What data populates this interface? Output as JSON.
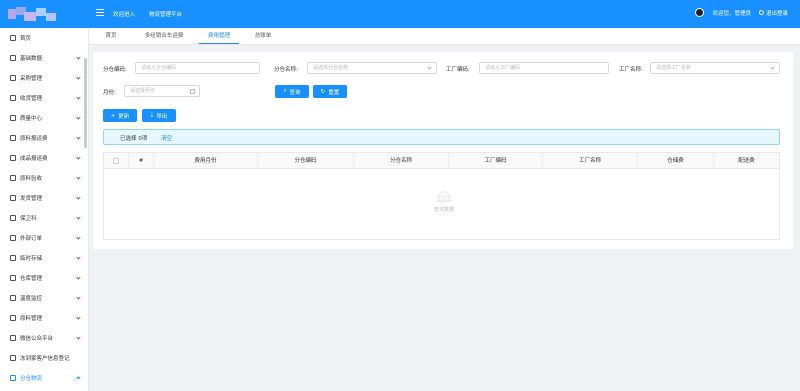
{
  "header": {
    "welcome": "欢迎进入",
    "system_name": "物流管理平台",
    "user_greeting": "欢迎您，管理员",
    "logout_label": "退出登录",
    "brand_color": "#1890ff"
  },
  "sidebar": {
    "items": [
      {
        "label": "首页",
        "icon": "home-icon"
      },
      {
        "label": "基础数据",
        "icon": "database-icon"
      },
      {
        "label": "采购管理",
        "icon": "cart-icon"
      },
      {
        "label": "收货管理",
        "icon": "receive-icon"
      },
      {
        "label": "质量中心",
        "icon": "quality-icon"
      },
      {
        "label": "原料报运费",
        "icon": "freight-icon"
      },
      {
        "label": "成品报运费",
        "icon": "product-freight-icon"
      },
      {
        "label": "原料验收",
        "icon": "inspect-icon"
      },
      {
        "label": "发货管理",
        "icon": "ship-icon"
      },
      {
        "label": "保卫科",
        "icon": "shield-icon"
      },
      {
        "label": "外部订单",
        "icon": "order-icon"
      },
      {
        "label": "临时存储",
        "icon": "storage-icon"
      },
      {
        "label": "仓库管理",
        "icon": "warehouse-icon"
      },
      {
        "label": "温度监控",
        "icon": "temperature-icon"
      },
      {
        "label": "原料管理",
        "icon": "material-icon"
      },
      {
        "label": "微信公众平台",
        "icon": "wechat-icon"
      },
      {
        "label": "冻到家客户信息登记",
        "icon": "customer-icon"
      },
      {
        "label": "分仓物流",
        "icon": "logistics-icon"
      }
    ]
  },
  "tabs": [
    {
      "label": "首页"
    },
    {
      "label": "多经销合车运费"
    },
    {
      "label": "费用管理"
    },
    {
      "label": "总账单"
    }
  ],
  "filters": {
    "branch_code_label": "分仓编码:",
    "branch_code_placeholder": "请输入分仓编码",
    "branch_name_label": "分仓名称:",
    "branch_name_placeholder": "请选择分仓名称",
    "factory_code_label": "工厂编码:",
    "factory_code_placeholder": "请输入工厂编码",
    "factory_name_label": "工厂名称:",
    "factory_name_placeholder": "请选择工厂名称",
    "month_label": "月份:",
    "month_placeholder": "请选择月份",
    "query_label": "查询",
    "reset_label": "重置"
  },
  "actions": {
    "update_label": "更新",
    "export_label": "导出"
  },
  "selection": {
    "selected_text": "已选择 0项",
    "clear_label": "清空"
  },
  "table": {
    "columns": [
      "#",
      "费用月份",
      "分仓编码",
      "分仓名称",
      "工厂编码",
      "工厂名称",
      "仓储费",
      "配送费"
    ],
    "empty_text": "暂无数据"
  }
}
